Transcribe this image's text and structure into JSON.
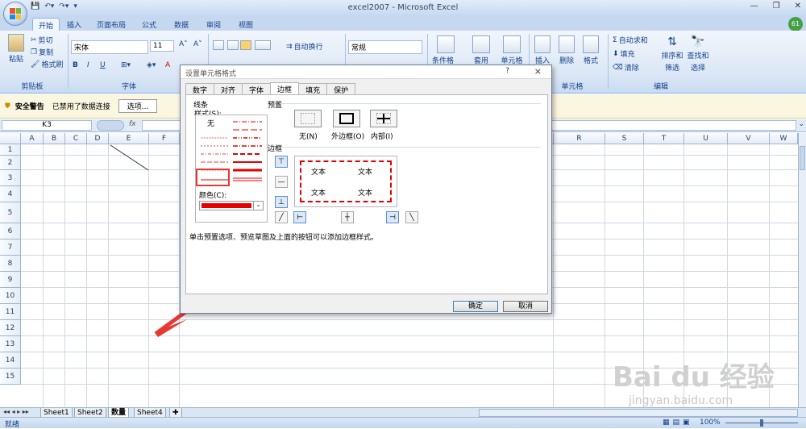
{
  "window": {
    "title": "excel2007 - Microsoft Excel",
    "avatar": "61"
  },
  "ribbon_tabs": [
    "开始",
    "插入",
    "页面布局",
    "公式",
    "数据",
    "审阅",
    "视图"
  ],
  "clipboard": {
    "paste": "粘贴",
    "cut": "剪切",
    "copy": "复制",
    "format_painter": "格式刷",
    "group": "剪贴板"
  },
  "font": {
    "name": "宋体",
    "size": "11",
    "group": "字体"
  },
  "alignment": {
    "wrap": "自动换行"
  },
  "number": {
    "format": "常规"
  },
  "styles": {
    "cond": "条件格式",
    "table": "套用",
    "cell": "单元格"
  },
  "cells": {
    "insert": "插入",
    "delete": "删除",
    "format": "格式",
    "group": "单元格"
  },
  "editing": {
    "autosum": "自动求和",
    "fill": "填充",
    "clear": "清除",
    "sort": "排序和",
    "sort2": "筛选",
    "find": "查找和",
    "find2": "选择",
    "group": "编辑"
  },
  "security": {
    "label": "安全警告",
    "message": "已禁用了数据连接",
    "options": "选项..."
  },
  "formula": {
    "namebox": "K3",
    "fx": "fx"
  },
  "columns": [
    "A",
    "B",
    "C",
    "D",
    "E",
    "F",
    "R",
    "S",
    "T",
    "U",
    "V",
    "W"
  ],
  "rows": [
    "1",
    "2",
    "3",
    "4",
    "5",
    "6",
    "7",
    "8",
    "9",
    "10",
    "11",
    "12",
    "13",
    "14",
    "15"
  ],
  "sheets": [
    "Sheet1",
    "Sheet2",
    "数量",
    "Sheet4"
  ],
  "status": {
    "ready": "就绪",
    "zoom": "100%"
  },
  "dialog": {
    "title": "设置单元格格式",
    "help": "?",
    "close": "×",
    "tabs": [
      "数字",
      "对齐",
      "字体",
      "边框",
      "填充",
      "保护"
    ],
    "line_group": "线条",
    "style_label": "样式(S):",
    "none": "无",
    "color_label": "颜色(C):",
    "color": "#e60000",
    "presets_label": "预置",
    "presets": [
      "无(N)",
      "外边框(O)",
      "内部(I)"
    ],
    "border_label": "边框",
    "preview_text": [
      "文本",
      "文本",
      "文本",
      "文本"
    ],
    "hint": "单击预置选项、预览草图及上面的按钮可以添加边框样式。",
    "ok": "确定",
    "cancel": "取消"
  },
  "watermark": {
    "brand": "Bai du 经验",
    "url": "jingyan.baidu.com"
  }
}
